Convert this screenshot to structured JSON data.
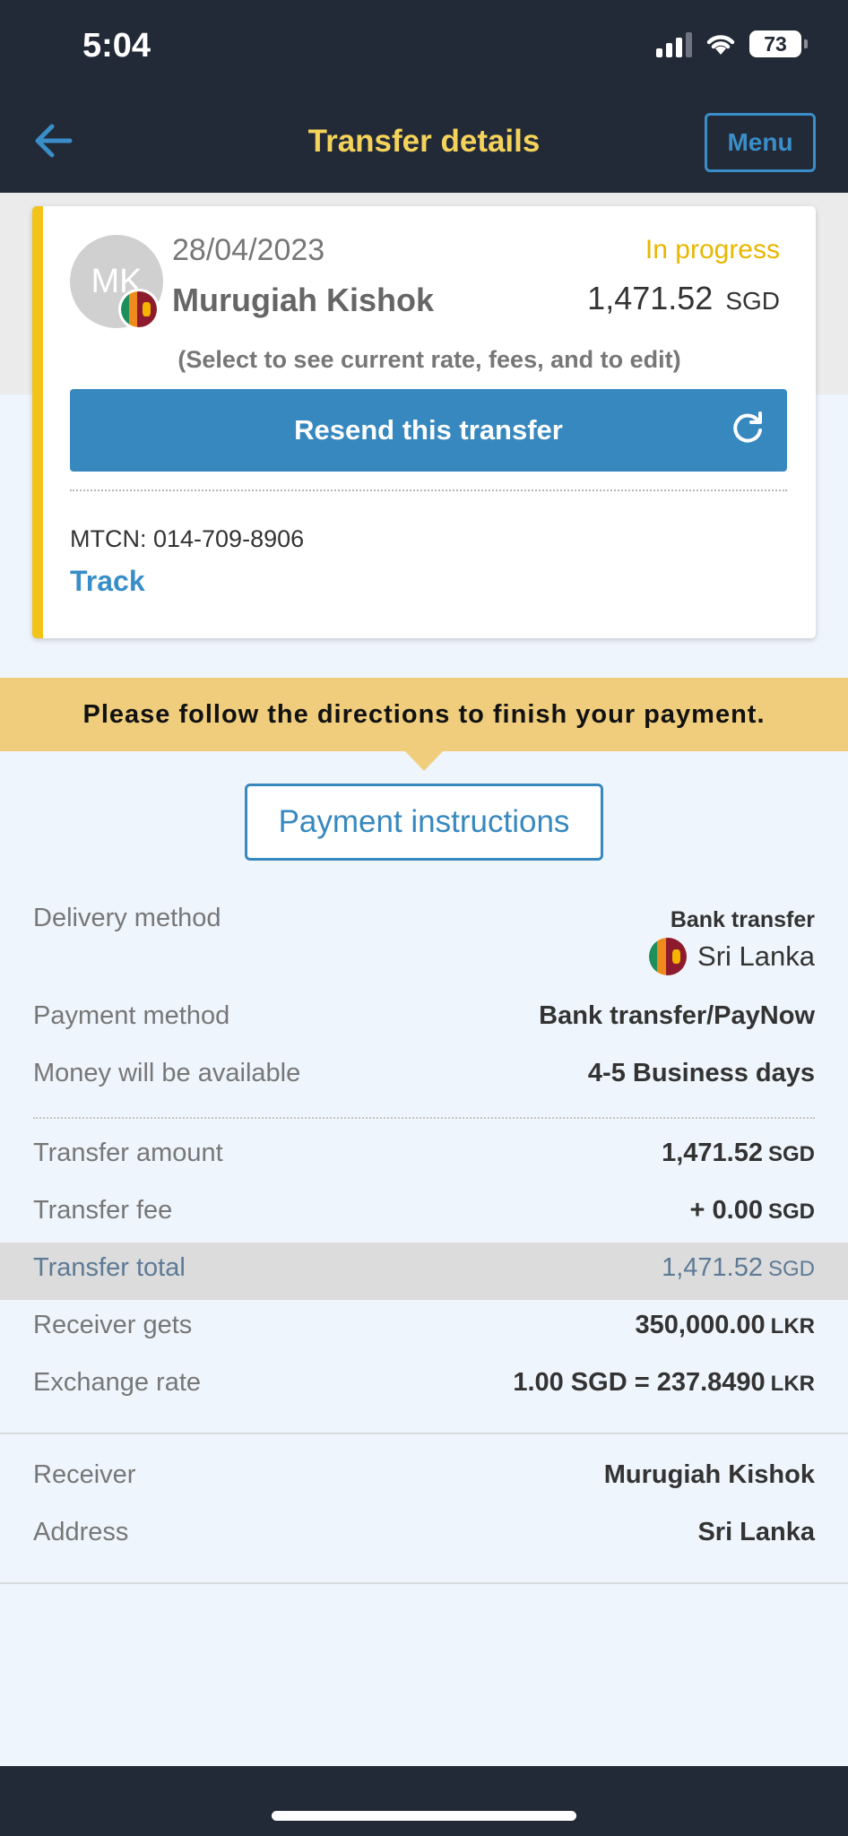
{
  "status_bar": {
    "time": "5:04",
    "battery": "73"
  },
  "nav": {
    "title": "Transfer details",
    "menu_label": "Menu"
  },
  "transfer_card": {
    "avatar_initials": "MK",
    "date": "28/04/2023",
    "status": "In progress",
    "receiver_name": "Murugiah Kishok",
    "amount": "1,471.52",
    "currency": "SGD",
    "hint": "(Select to see current rate, fees, and to edit)",
    "resend_label": "Resend this transfer",
    "mtcn": "MTCN: 014-709-8906",
    "track_label": "Track"
  },
  "notice": {
    "text": "Please follow the directions to finish your payment."
  },
  "payment_instructions_label": "Payment instructions",
  "details": {
    "delivery": {
      "label": "Delivery method",
      "type": "Bank transfer",
      "country": "Sri Lanka"
    },
    "rows": [
      {
        "label": "Payment method",
        "value": "Bank transfer/PayNow",
        "currency": ""
      },
      {
        "label": "Money will be available",
        "value": "4-5 Business days",
        "currency": ""
      },
      {
        "label": "Transfer amount",
        "value": "1,471.52",
        "currency": "SGD"
      },
      {
        "label": "Transfer fee",
        "value": "+ 0.00",
        "currency": "SGD"
      },
      {
        "label": "Transfer total",
        "value": "1,471.52",
        "currency": "SGD"
      },
      {
        "label": "Receiver gets",
        "value": "350,000.00",
        "currency": "LKR"
      },
      {
        "label": "Exchange rate",
        "value": "1.00 SGD = 237.8490",
        "currency": "LKR"
      }
    ],
    "receiver_rows": [
      {
        "label": "Receiver",
        "value": "Murugiah Kishok"
      },
      {
        "label": "Address",
        "value": "Sri Lanka"
      }
    ]
  },
  "colors": {
    "accent": "#3788bf",
    "status": "#e8b700",
    "nav_bg": "#222a37",
    "nav_title": "#f5d35b",
    "notice_bg": "#efcd7c"
  }
}
